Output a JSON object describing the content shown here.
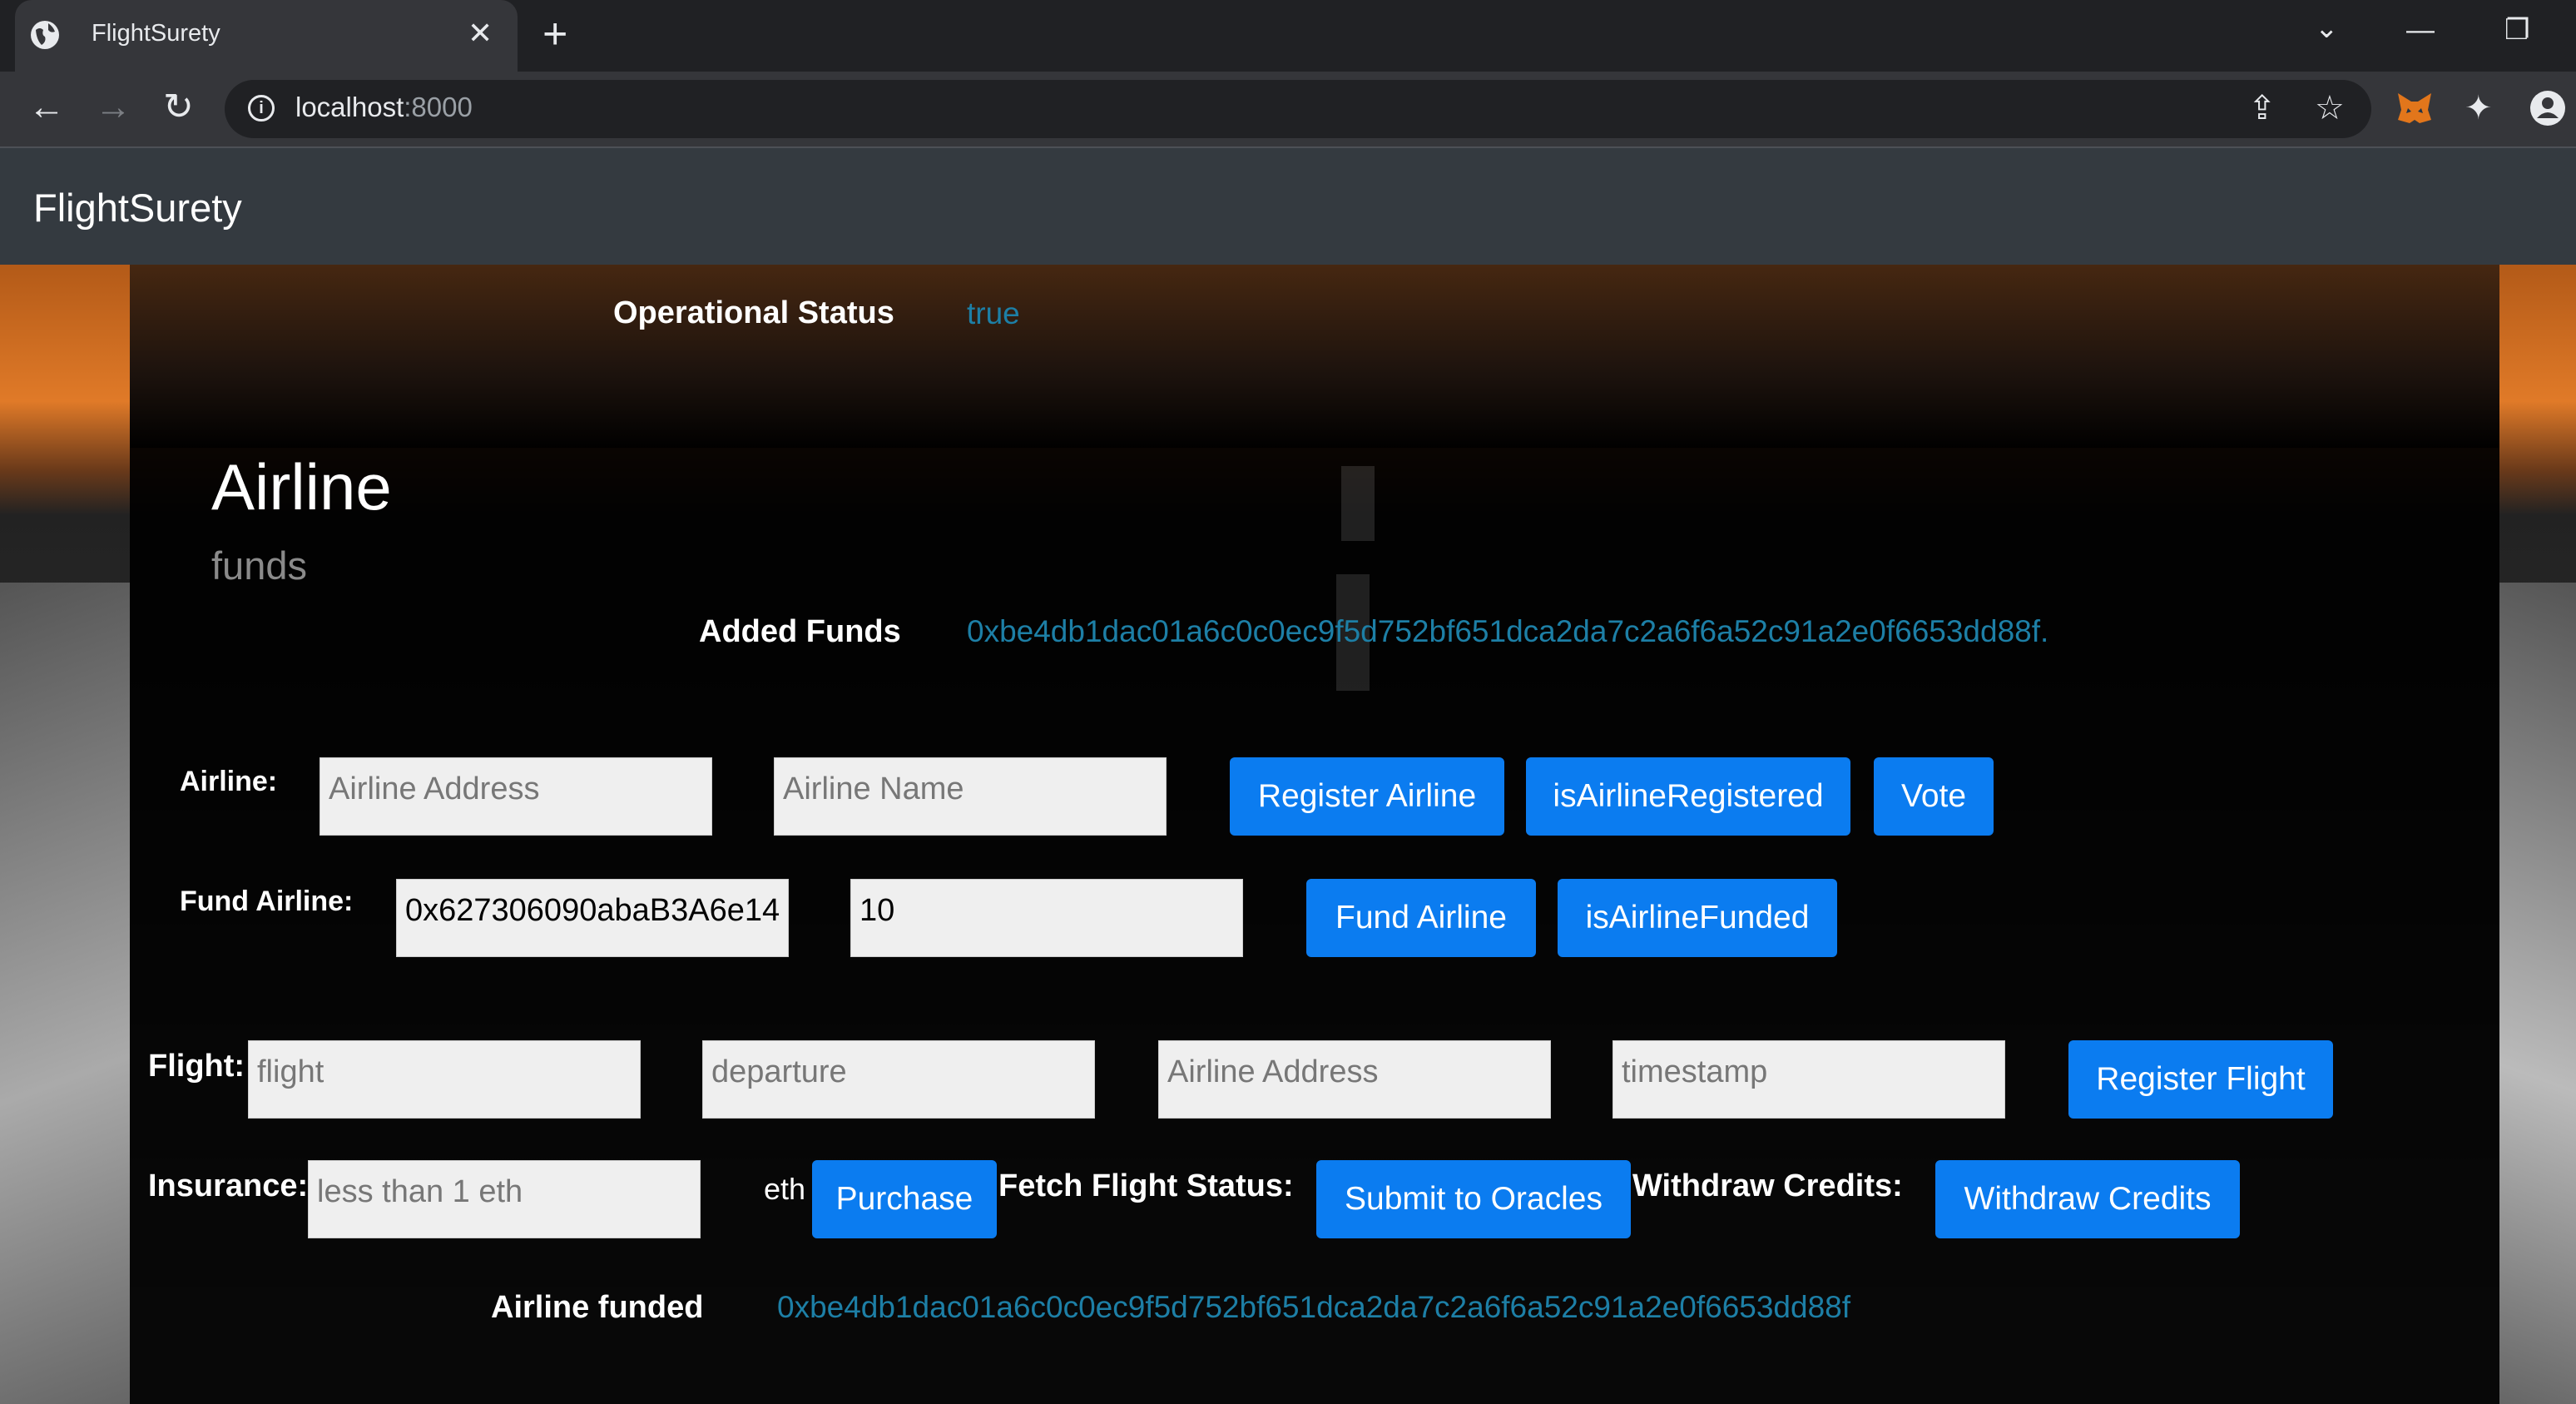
{
  "browser": {
    "tab_title": "FlightSurety",
    "tab_close": "✕",
    "new_tab": "+",
    "url_host": "localhost",
    "url_port": ":8000",
    "window_controls": [
      "⌄",
      "—",
      "❐"
    ],
    "icons": [
      "back-icon",
      "forward-icon",
      "reload-icon",
      "share-icon",
      "star-icon",
      "metamask-icon",
      "extensions-icon",
      "profile-icon"
    ]
  },
  "navbar": {
    "brand": "FlightSurety"
  },
  "status": {
    "label": "Operational Status",
    "value": "true"
  },
  "airline_section": {
    "title": "Airline",
    "subtitle": "funds",
    "added_funds_label": "Added Funds",
    "added_funds_value": "0xbe4db1dac01a6c0c0ec9f5d752bf651dca2da7c2a6f6a52c91a2e0f6653dd88f."
  },
  "airline_form": {
    "label": "Airline:",
    "address_placeholder": "Airline Address",
    "name_placeholder": "Airline Name",
    "register_button": "Register Airline",
    "is_registered_button": "isAirlineRegistered",
    "vote_button": "Vote"
  },
  "fund_form": {
    "label": "Fund Airline:",
    "address_value": "0x627306090abaB3A6e14",
    "amount_value": "10",
    "fund_button": "Fund Airline",
    "is_funded_button": "isAirlineFunded"
  },
  "flight_form": {
    "label": "Flight:",
    "flight_placeholder": "flight",
    "departure_placeholder": "departure",
    "airline_placeholder": "Airline Address",
    "timestamp_placeholder": "timestamp",
    "register_button": "Register Flight"
  },
  "insurance_form": {
    "label": "Insurance:",
    "amount_placeholder": "less than 1 eth",
    "unit": "eth",
    "purchase_button": "Purchase",
    "fetch_label": "Fetch Flight Status:",
    "submit_button": "Submit to Oracles",
    "withdraw_label": "Withdraw Credits:",
    "withdraw_button": "Withdraw Credits"
  },
  "result": {
    "label": "Airline funded",
    "value": "0xbe4db1dac01a6c0c0ec9f5d752bf651dca2da7c2a6f6a52c91a2e0f6653dd88f"
  },
  "colors": {
    "accent": "#0b7cf0",
    "value_teal": "#1d7fa6",
    "navbar": "#343a40"
  }
}
